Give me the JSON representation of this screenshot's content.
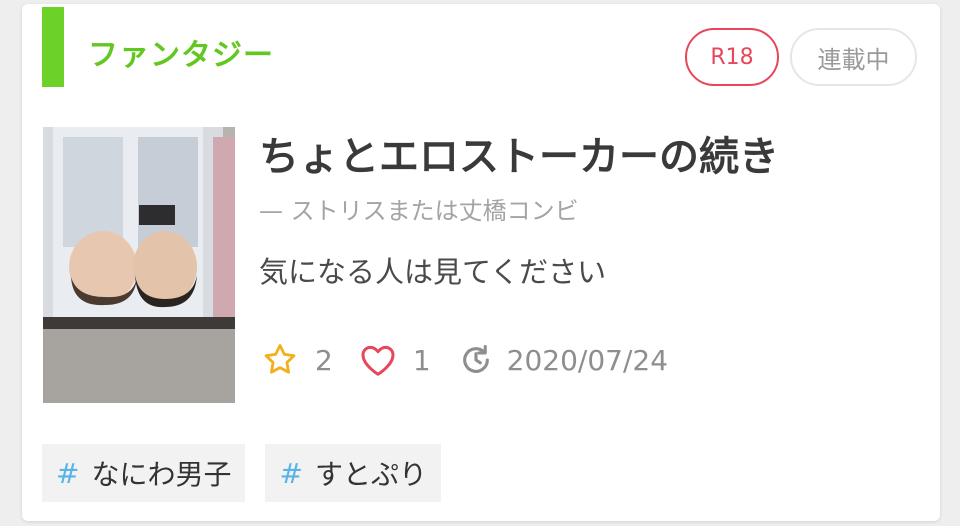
{
  "genre": "ファンタジー",
  "badges": {
    "rating": "R18",
    "status": "連載中"
  },
  "story": {
    "title": "ちょとエロストーカーの続き",
    "subtitle": "— ストリスまたは丈橋コンビ",
    "description": "気になる人は見てください"
  },
  "stats": {
    "stars": "2",
    "likes": "1",
    "updated": "2020/07/24"
  },
  "tags": [
    {
      "hash": "#",
      "label": "なにわ男子"
    },
    {
      "hash": "#",
      "label": "すとぷり"
    }
  ],
  "icons": {
    "star": "star-icon",
    "heart": "heart-icon",
    "updated": "history-icon",
    "thumbnail": "story-thumbnail-photo"
  },
  "colors": {
    "genre_accent": "#6cd228",
    "rating_badge": "#e8475a",
    "star": "#f2b01e",
    "heart": "#e8475a",
    "hashtag": "#58b4e6"
  }
}
